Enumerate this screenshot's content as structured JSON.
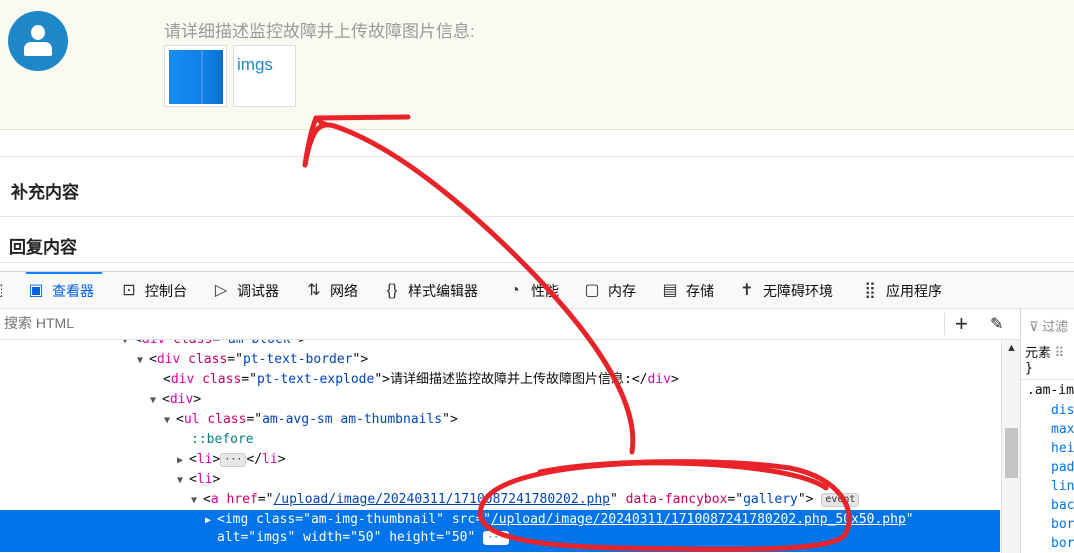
{
  "page": {
    "explode_text": "请详细描述监控故障并上传故障图片信息:",
    "thumb_alt": "imgs",
    "supplement_title": "补充内容",
    "reply_title": "回复内容"
  },
  "devtools": {
    "tabs": [
      {
        "label": "查看器",
        "icon": "inspector-icon"
      },
      {
        "label": "控制台",
        "icon": "console-icon"
      },
      {
        "label": "调试器",
        "icon": "debugger-icon"
      },
      {
        "label": "网络",
        "icon": "network-icon"
      },
      {
        "label": "样式编辑器",
        "icon": "style-editor-icon"
      },
      {
        "label": "性能",
        "icon": "performance-icon"
      },
      {
        "label": "内存",
        "icon": "memory-icon"
      },
      {
        "label": "存储",
        "icon": "storage-icon"
      },
      {
        "label": "无障碍环境",
        "icon": "accessibility-icon"
      },
      {
        "label": "应用程序",
        "icon": "application-icon"
      }
    ],
    "active_tab": "查看器",
    "search_placeholder": "搜索 HTML",
    "side": {
      "filter": "过滤",
      "element_label": "元素",
      "close_brace": "}",
      "selector": ".am-img",
      "props": [
        "dis",
        "max",
        "hei",
        "pad",
        "lin",
        "bac",
        "bor",
        "bor"
      ]
    },
    "tree": {
      "l0_tag": "div",
      "l0_attr": "class",
      "l0_val": "am-block",
      "l1_tag": "div",
      "l1_attr": "class",
      "l1_val": "pt-text-border",
      "l2_tag": "div",
      "l2_attr": "class",
      "l2_val": "pt-text-explode",
      "l2_text": "请详细描述监控故障并上传故障图片信息:",
      "l3_tag": "div",
      "l4_tag": "ul",
      "l4_attr": "class",
      "l4_val": "am-avg-sm am-thumbnails",
      "l5_pseudo": "::before",
      "l6_tag": "li",
      "l7_tag": "li",
      "l8_tag": "a",
      "l8_attr1": "href",
      "l8_val1": "/upload/image/20240311/1710087241780202.php",
      "l8_attr2": "data-fancybox",
      "l8_val2": "gallery",
      "l8_badge": "event",
      "l9_tag": "img",
      "l9_attr1": "class",
      "l9_val1": "am-img-thumbnail",
      "l9_attr2": "src",
      "l9_val2": "/upload/image/20240311/1710087241780202.php_50x50.php",
      "l9_attr3": "alt",
      "l9_val3": "imgs",
      "l9_attr4": "width",
      "l9_val4": "50",
      "l9_attr5": "height",
      "l9_val5": "50"
    }
  },
  "colors": {
    "accent": "#0a84ff",
    "selected_row": "#0074e8",
    "annotation": "#e8242a",
    "avatar": "#1e88c9"
  }
}
